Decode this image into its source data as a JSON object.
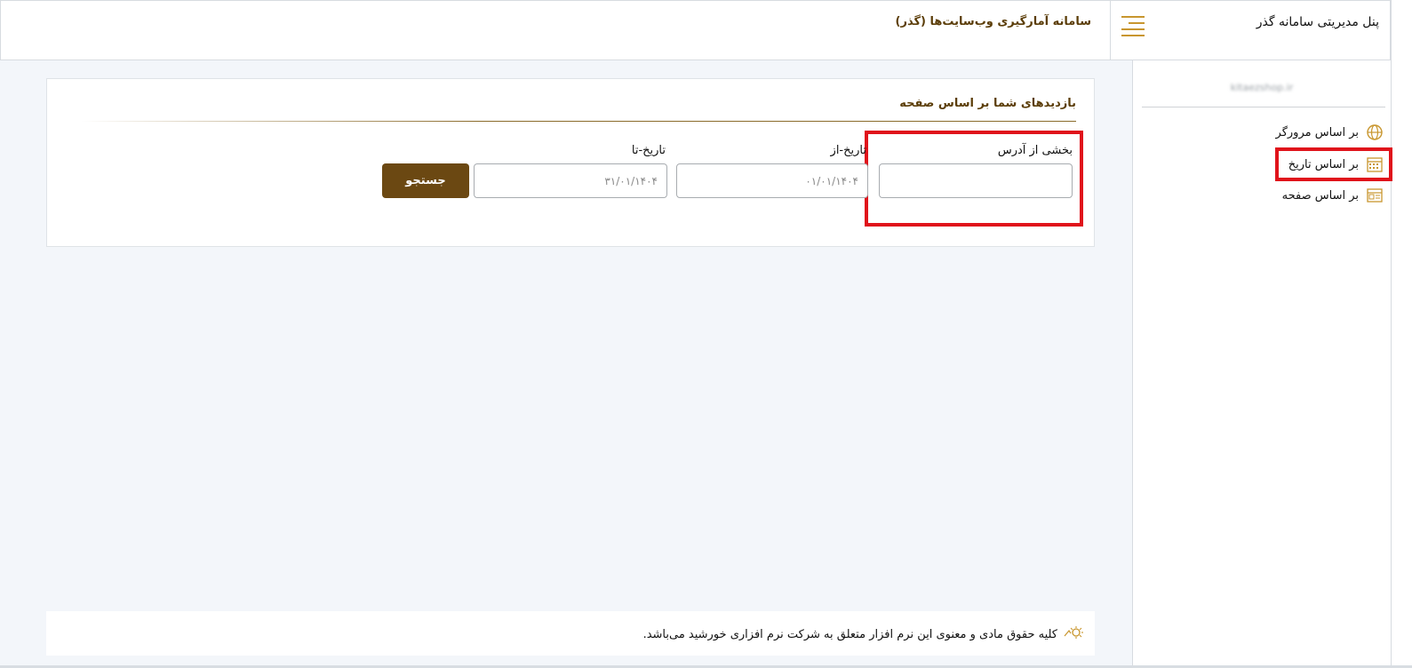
{
  "header": {
    "brand_title": "پنل مدیریتی سامانه گذر",
    "system_title": "سامانه آمارگیری وب‌سایت‌ها (گذر)",
    "menu_toggle_icon": "hamburger-icon"
  },
  "sidebar": {
    "site_name": "kitaezshop.ir",
    "items": [
      {
        "label": "بر اساس مرورگر",
        "icon": "globe-icon"
      },
      {
        "label": "بر اساس تاریخ",
        "icon": "calendar-icon"
      },
      {
        "label": "بر اساس صفحه",
        "icon": "page-icon"
      }
    ]
  },
  "main": {
    "card_title": "بازدیدهای شما بر اساس صفحه",
    "address_label": "بخشی از آدرس",
    "address_value": "",
    "date_from_label": "تاریخ-از",
    "date_from_value": "۰۱/۰۱/۱۴۰۴",
    "date_to_label": "تاریخ-تا",
    "date_to_value": "۳۱/۰۱/۱۴۰۴",
    "search_label": "جستجو"
  },
  "footer": {
    "text": "کلیه حقوق مادی و معنوی این نرم افزار متعلق به شرکت نرم افزاری خورشید می‌باشد."
  },
  "colors": {
    "accent": "#c8962e",
    "title_brown": "#5b3d08",
    "button_brown": "#6b4812",
    "highlight_red": "#e0131b"
  }
}
